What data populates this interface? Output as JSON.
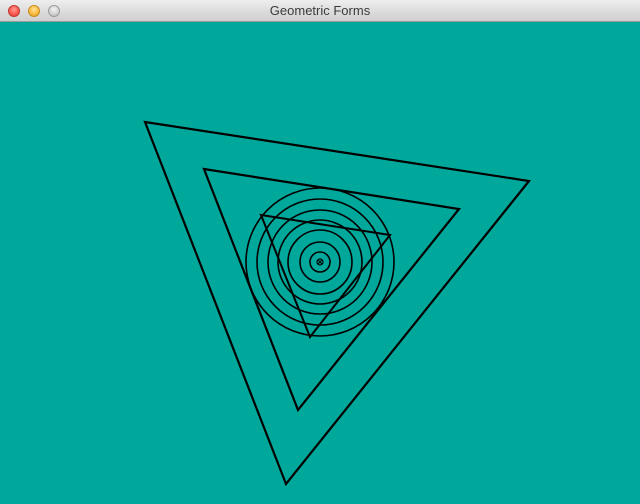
{
  "window": {
    "title": "Geometric Forms"
  },
  "colors": {
    "canvas_background": "#00a79b",
    "stroke": "#000000",
    "titlebar": "#dcdcdc",
    "close_button": "#fc5b53",
    "minimize_button": "#fdbc40",
    "zoom_button": "#c8c8c8"
  },
  "icons": {
    "close": "close-icon",
    "minimize": "minimize-icon",
    "zoom": "zoom-icon"
  },
  "drawing": {
    "triangles": 3,
    "concentric_circles": 7
  }
}
